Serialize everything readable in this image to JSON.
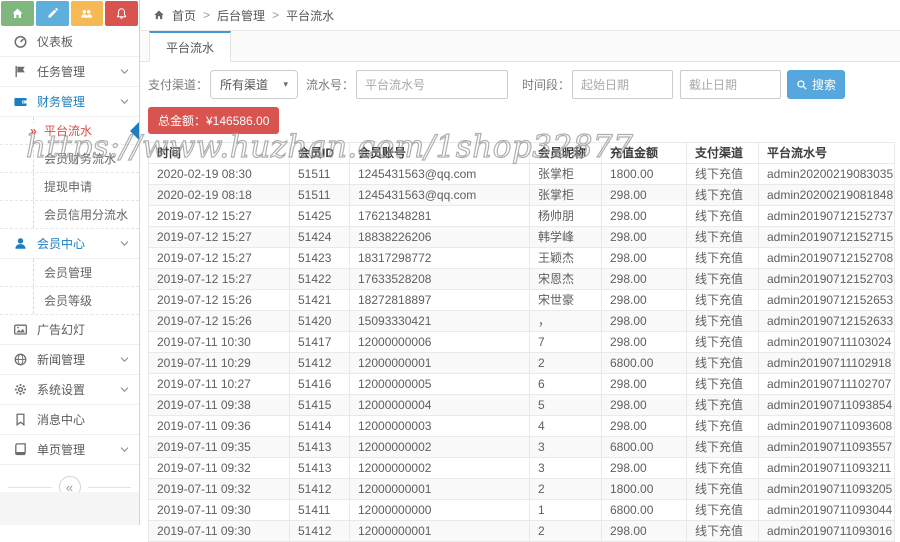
{
  "topbar": {
    "buttons": [
      {
        "icon": "home-icon",
        "color": "#7fb77e"
      },
      {
        "icon": "pencil-icon",
        "color": "#5fafdc"
      },
      {
        "icon": "group-icon",
        "color": "#f6ba55"
      },
      {
        "icon": "bell-icon",
        "color": "#d9534f"
      }
    ]
  },
  "sidebar": {
    "items": [
      {
        "label": "仪表板",
        "icon": "gauge-icon"
      },
      {
        "label": "任务管理",
        "icon": "flag-icon",
        "chevron": true
      },
      {
        "label": "财务管理",
        "icon": "wallet-icon",
        "chevron": true,
        "active": true
      },
      {
        "label": "平台流水",
        "sub": true,
        "active": true
      },
      {
        "label": "会员财务流水",
        "sub": true
      },
      {
        "label": "提现申请",
        "sub": true
      },
      {
        "label": "会员信用分流水",
        "sub": true
      },
      {
        "label": "会员中心",
        "icon": "user-icon",
        "chevron": true,
        "active": true
      },
      {
        "label": "会员管理",
        "sub": true
      },
      {
        "label": "会员等级",
        "sub": true
      },
      {
        "label": "广告幻灯",
        "icon": "image-icon"
      },
      {
        "label": "新闻管理",
        "icon": "globe-icon",
        "chevron": true
      },
      {
        "label": "系统设置",
        "icon": "gear-icon",
        "chevron": true
      },
      {
        "label": "消息中心",
        "icon": "bookmark-icon"
      },
      {
        "label": "单页管理",
        "icon": "book-icon",
        "chevron": true
      }
    ],
    "collapse_icon": "collapse-left-icon",
    "collapse_glyph": "«"
  },
  "breadcrumb": {
    "home_icon": "home-icon",
    "items": [
      "首页",
      "后台管理",
      "平台流水"
    ],
    "separator": ">"
  },
  "tabs": [
    {
      "label": "平台流水",
      "active": true
    }
  ],
  "filters": {
    "channel_label": "支付渠道：",
    "channel_value": "所有渠道",
    "caret_icon": "caret-down-icon",
    "flow_label": "流水号：",
    "flow_placeholder": "平台流水号",
    "time_label": "时间段：",
    "start_placeholder": "起始日期",
    "end_placeholder": "截止日期",
    "search_icon": "search-icon",
    "search_label": "搜索"
  },
  "summary": {
    "total": "总金额：¥146586.00",
    "badge_color": "#d9534f"
  },
  "table": {
    "columns": [
      "时间",
      "会员ID",
      "会员账号",
      "会员昵称",
      "充值金额",
      "支付渠道",
      "平台流水号"
    ],
    "rows": [
      [
        "2020-02-19 08:30",
        "51511",
        "1245431563@qq.com",
        "张掌柜",
        "1800.00",
        "线下充值",
        "admin20200219083035"
      ],
      [
        "2020-02-19 08:18",
        "51511",
        "1245431563@qq.com",
        "张掌柜",
        "298.00",
        "线下充值",
        "admin20200219081848"
      ],
      [
        "2019-07-12 15:27",
        "51425",
        "17621348281",
        "杨帅朋",
        "298.00",
        "线下充值",
        "admin20190712152737"
      ],
      [
        "2019-07-12 15:27",
        "51424",
        "18838226206",
        "韩学峰",
        "298.00",
        "线下充值",
        "admin20190712152715"
      ],
      [
        "2019-07-12 15:27",
        "51423",
        "18317298772",
        "王颖杰",
        "298.00",
        "线下充值",
        "admin20190712152708"
      ],
      [
        "2019-07-12 15:27",
        "51422",
        "17633528208",
        "宋恩杰",
        "298.00",
        "线下充值",
        "admin20190712152703"
      ],
      [
        "2019-07-12 15:26",
        "51421",
        "18272818897",
        "宋世豪",
        "298.00",
        "线下充值",
        "admin20190712152653"
      ],
      [
        "2019-07-12 15:26",
        "51420",
        "15093330421",
        "，",
        "298.00",
        "线下充值",
        "admin20190712152633"
      ],
      [
        "2019-07-11 10:30",
        "51417",
        "12000000006",
        "7",
        "298.00",
        "线下充值",
        "admin20190711103024"
      ],
      [
        "2019-07-11 10:29",
        "51412",
        "12000000001",
        "2",
        "6800.00",
        "线下充值",
        "admin20190711102918"
      ],
      [
        "2019-07-11 10:27",
        "51416",
        "12000000005",
        "6",
        "298.00",
        "线下充值",
        "admin20190711102707"
      ],
      [
        "2019-07-11 09:38",
        "51415",
        "12000000004",
        "5",
        "298.00",
        "线下充值",
        "admin20190711093854"
      ],
      [
        "2019-07-11 09:36",
        "51414",
        "12000000003",
        "4",
        "298.00",
        "线下充值",
        "admin20190711093608"
      ],
      [
        "2019-07-11 09:35",
        "51413",
        "12000000002",
        "3",
        "6800.00",
        "线下充值",
        "admin20190711093557"
      ],
      [
        "2019-07-11 09:32",
        "51413",
        "12000000002",
        "3",
        "298.00",
        "线下充值",
        "admin20190711093211"
      ],
      [
        "2019-07-11 09:32",
        "51412",
        "12000000001",
        "2",
        "1800.00",
        "线下充值",
        "admin20190711093205"
      ],
      [
        "2019-07-11 09:30",
        "51411",
        "12000000000",
        "1",
        "6800.00",
        "线下充值",
        "admin20190711093044"
      ],
      [
        "2019-07-11 09:30",
        "51412",
        "12000000001",
        "2",
        "298.00",
        "线下充值",
        "admin20190711093016"
      ]
    ]
  },
  "watermark": "https://www.huzhan.com/1shop32877"
}
